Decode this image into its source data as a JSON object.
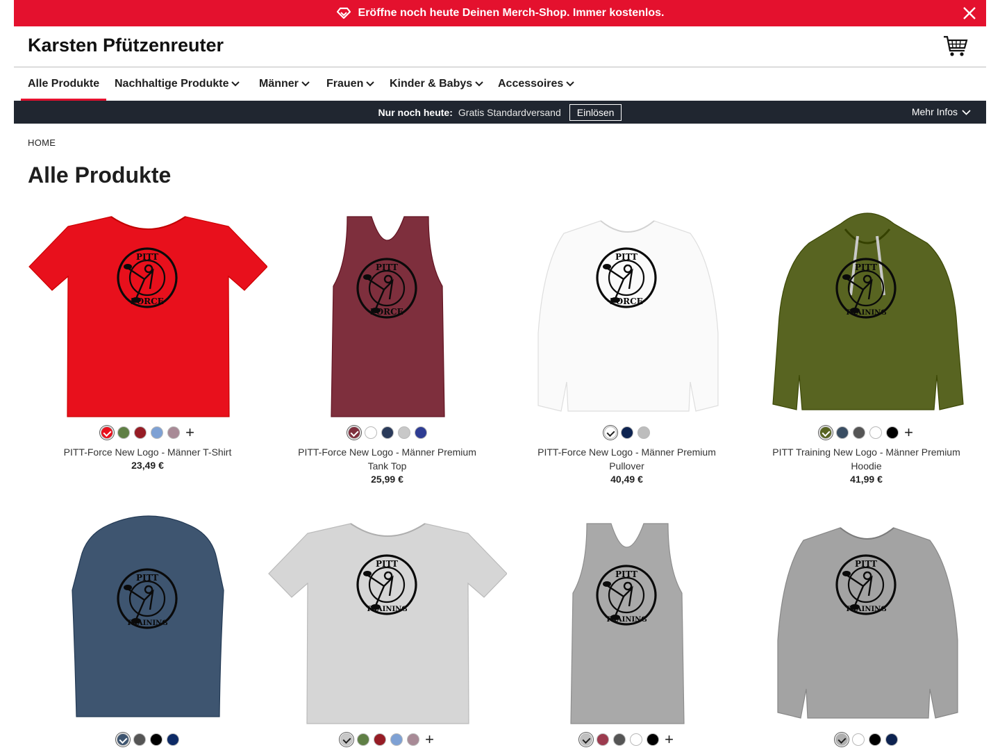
{
  "promo": {
    "text": "Eröffne noch heute Deinen Merch-Shop. Immer kostenlos."
  },
  "header": {
    "brand": "Karsten Pfützenreuter"
  },
  "nav": {
    "items": [
      {
        "label": "Alle Produkte",
        "active": true
      },
      {
        "label": "Nachhaltige Produkte"
      },
      {
        "label": "Männer"
      },
      {
        "label": "Frauen"
      },
      {
        "label": "Kinder & Babys"
      },
      {
        "label": "Accessoires"
      }
    ]
  },
  "infobar": {
    "strong": "Nur noch heute:",
    "text": "Gratis Standardversand",
    "redeem": "Einlösen",
    "more": "Mehr Infos"
  },
  "breadcrumb": "HOME",
  "page_title": "Alle Produkte",
  "products": [
    {
      "name": "PITT-Force New Logo - Männer T-Shirt",
      "price": "23,49 €",
      "garment": "tshirt",
      "color": "#e8101c",
      "logo_text": [
        "PITT",
        "FORCE"
      ],
      "swatches": [
        "#e8101c",
        "#5f7f45",
        "#961c25",
        "#7ea1d4",
        "#a88a96"
      ],
      "selected": 0,
      "more": "+"
    },
    {
      "name": "PITT-Force New Logo - Männer Premium Tank Top",
      "price": "25,99 €",
      "garment": "tank",
      "color": "#7e2f3d",
      "logo_text": [
        "PITT",
        "FORCE"
      ],
      "swatches": [
        "#7e2f3d",
        "#ffffff",
        "#2a3a5a",
        "#c8c8c8",
        "#2e3c93"
      ],
      "selected": 0,
      "more": ""
    },
    {
      "name": "PITT-Force New Logo - Männer Premium Pullover",
      "price": "40,49 €",
      "garment": "sweater",
      "color": "#fafafa",
      "logo_text": [
        "PITT",
        "FORCE"
      ],
      "swatches": [
        "#ffffff",
        "#0d2350",
        "#bdbdbd"
      ],
      "selected": 0,
      "more": ""
    },
    {
      "name": "PITT Training New Logo - Männer Premium Hoodie",
      "price": "41,99 €",
      "garment": "hoodie",
      "color": "#586421",
      "logo_text": [
        "PITT",
        "TRAINING"
      ],
      "swatches": [
        "#586421",
        "#3a4e63",
        "#555555",
        "#ffffff",
        "#000000"
      ],
      "selected": 0,
      "more": "+"
    },
    {
      "name": "",
      "price": "",
      "garment": "hoodie-back",
      "color": "#3e5570",
      "logo_text": [
        "PITT",
        "TRAINING"
      ],
      "swatches": [
        "#3e5570",
        "#555555",
        "#000000",
        "#0d2a66"
      ],
      "selected": 0,
      "more": ""
    },
    {
      "name": "",
      "price": "",
      "garment": "tshirt",
      "color": "#d6d6d6",
      "logo_text": [
        "PITT",
        "TRAINING"
      ],
      "swatches": [
        "#c8c8c8",
        "#5f7f45",
        "#961c25",
        "#7ea1d4",
        "#a88a96"
      ],
      "selected": 0,
      "more": "+"
    },
    {
      "name": "",
      "price": "",
      "garment": "tank",
      "color": "#a9a9a9",
      "logo_text": [
        "PITT",
        "TRAINING"
      ],
      "swatches": [
        "#c0c0c0",
        "#9c3b4e",
        "#555555",
        "#ffffff",
        "#000000"
      ],
      "selected": 0,
      "more": "+"
    },
    {
      "name": "",
      "price": "",
      "garment": "sweater",
      "color": "#a3a3a3",
      "logo_text": [
        "PITT",
        "TRAINING"
      ],
      "swatches": [
        "#b0b0b0",
        "#ffffff",
        "#000000",
        "#0d2350"
      ],
      "selected": 0,
      "more": ""
    }
  ]
}
